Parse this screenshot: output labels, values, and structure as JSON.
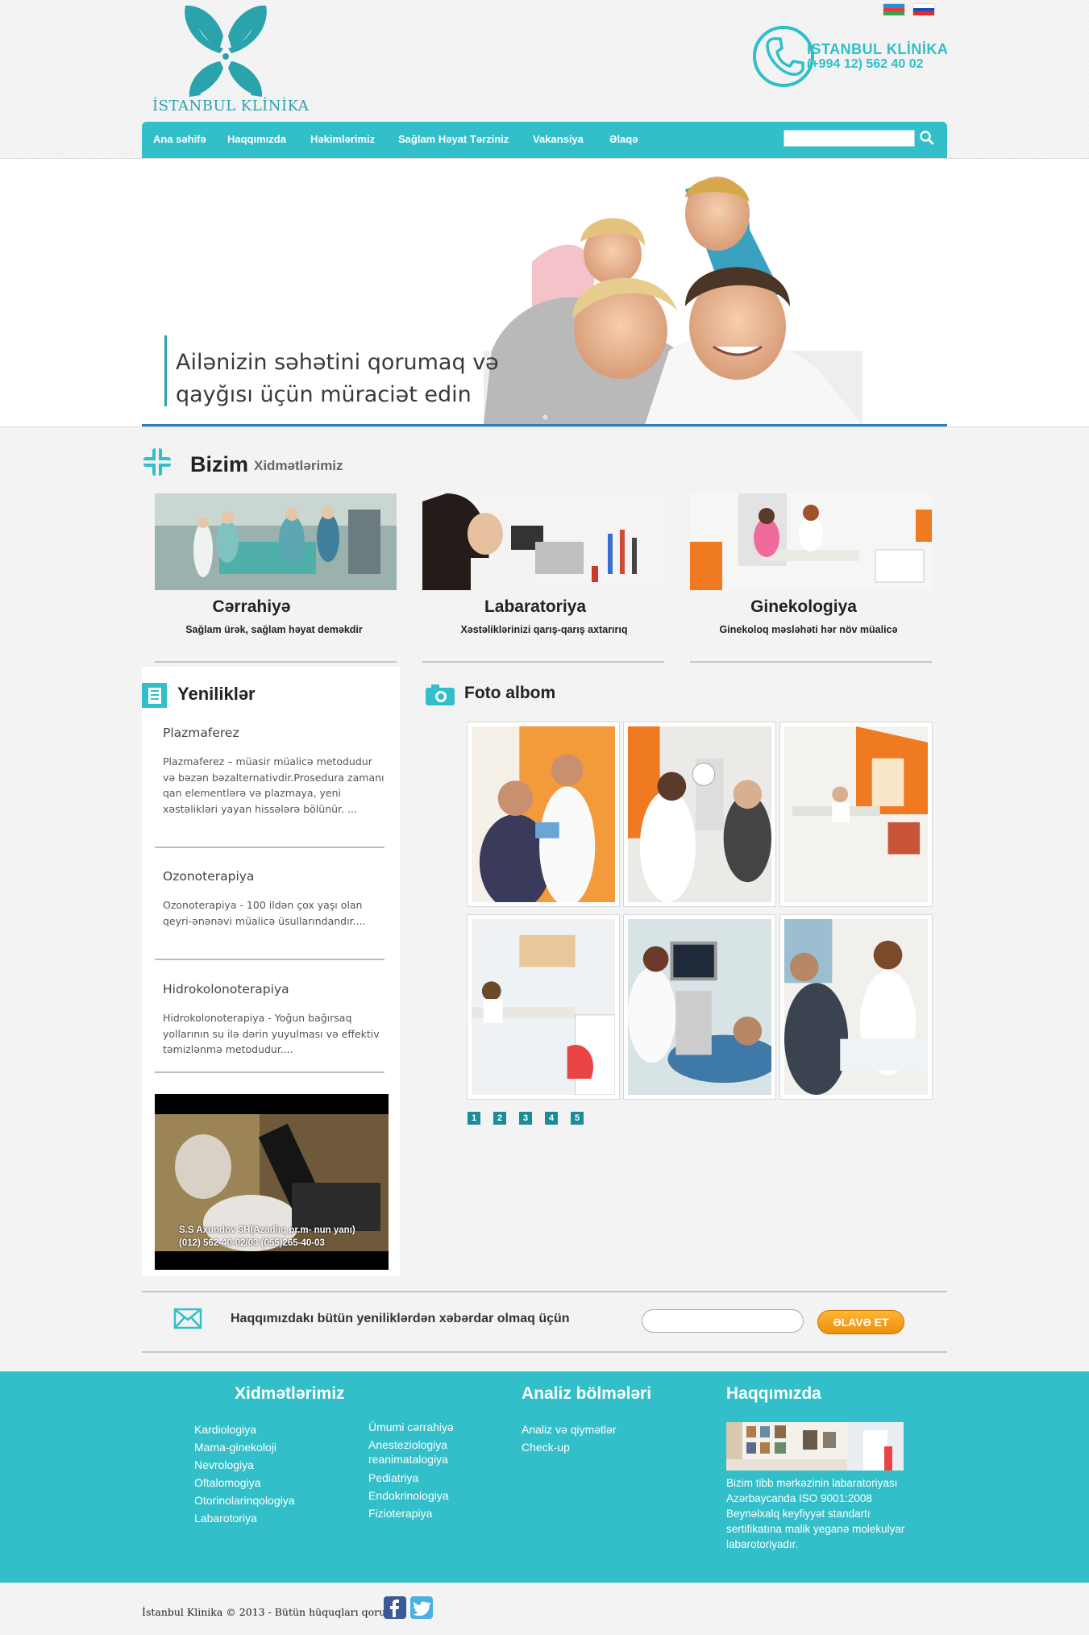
{
  "header": {
    "logo_text": "İSTANBUL KLİNİKA",
    "languages": [
      "az-flag-icon",
      "ru-flag-icon"
    ],
    "phone_title": "İSTANBUL KLİNİKA",
    "phone_number": "(+994 12) 562 40 02"
  },
  "nav": {
    "items": [
      {
        "label": "Ana səhifə"
      },
      {
        "label": "Haqqımızda"
      },
      {
        "label": "Həkimlərimiz"
      },
      {
        "label": "Sağlam Həyat Tərziniz"
      },
      {
        "label": "Vakansiya"
      },
      {
        "label": "Əlaqə"
      }
    ],
    "search_value": "",
    "search_icon": "search-icon"
  },
  "hero": {
    "line1": "Ailənizin səhətini qorumaq və",
    "line2": "qayğısı üçün müraciət edin",
    "slides": 2,
    "active_slide": 1
  },
  "services": {
    "title": "Bizim",
    "subtitle": "Xidmətlərimiz",
    "items": [
      {
        "title": "Cərrahiyə",
        "subtitle": "Sağlam ürək, sağlam həyat deməkdir"
      },
      {
        "title": "Labaratoriya",
        "subtitle": "Xəstəliklərinizi qarış-qarış axtarırıq"
      },
      {
        "title": "Ginekologiya",
        "subtitle": "Ginekoloq məsləhəti hər növ müalicə"
      }
    ]
  },
  "news": {
    "title": "Yeniliklər",
    "items": [
      {
        "title": "Plazmaferez",
        "body": "Plazmaferez – müasir müalicə metodudur və bəzən bəzalternativdir.Prosedura zamanı qan elementlərə və plazmaya, yeni xəstəlikləri yayan hissələrə bölünür. ..."
      },
      {
        "title": "Ozonoterapiya",
        "body": "Ozonoterapiya - 100 ildən çox yaşı olan qeyri-ənənəvi müalicə üsullarındandır...."
      },
      {
        "title": "Hidrokolonoterapiya",
        "body": "Hidrokolonoterapiya - Yoğun bağırsaq yollarının su ilə dərin yuyulması və effektiv təmizlənmə metodudur...."
      }
    ],
    "video_caption_1": "S.S Axundov 3H(Azadlıq pr.m- nun yanı)",
    "video_caption_2": "(012) 562-40-02/03 (055)265-40-03"
  },
  "album": {
    "title": "Foto albom",
    "pages": [
      "1",
      "2",
      "3",
      "4",
      "5"
    ]
  },
  "newsletter": {
    "text": "Haqqımızdakı bütün yeniliklərdən xəbərdar olmaq üçün",
    "input_value": "",
    "button": "ƏLAVƏ ET"
  },
  "footer": {
    "services_title": "Xidmətlərimiz",
    "services_col1": [
      "Kardiologiya",
      "Mama-ginekoloji",
      "Nevrologiya",
      "Oftalomogiya",
      "Otorinolarinqologiya",
      "Labarotoriya"
    ],
    "services_col2": [
      "Ümumi cərrahiyə",
      "Anesteziologiya",
      "reanimatalogiya",
      "Pediatriya",
      "Endokrinologiya",
      "Fizioterapiya"
    ],
    "analysis_title": "Analiz bölmələri",
    "analysis_links": [
      "Analiz və qiymətlər",
      "Check-up"
    ],
    "about_title": "Haqqımızda",
    "about_text": "Bizim tibb mərkəzinin labaratoriyası Azərbaycanda ISO 9001:2008 Beynəlxalq keyfiyyət standartı sertifikatına malik yeganə molekulyar labarotoriyadır."
  },
  "copyright": "İstanbul Klinika © 2013 - Bütün hüquqları qorunur.",
  "social": [
    "facebook-icon",
    "twitter-icon"
  ],
  "colors": {
    "brand": "#33bfc9",
    "dark_teal": "#1a8c9a",
    "accent_orange": "#f29d17"
  }
}
